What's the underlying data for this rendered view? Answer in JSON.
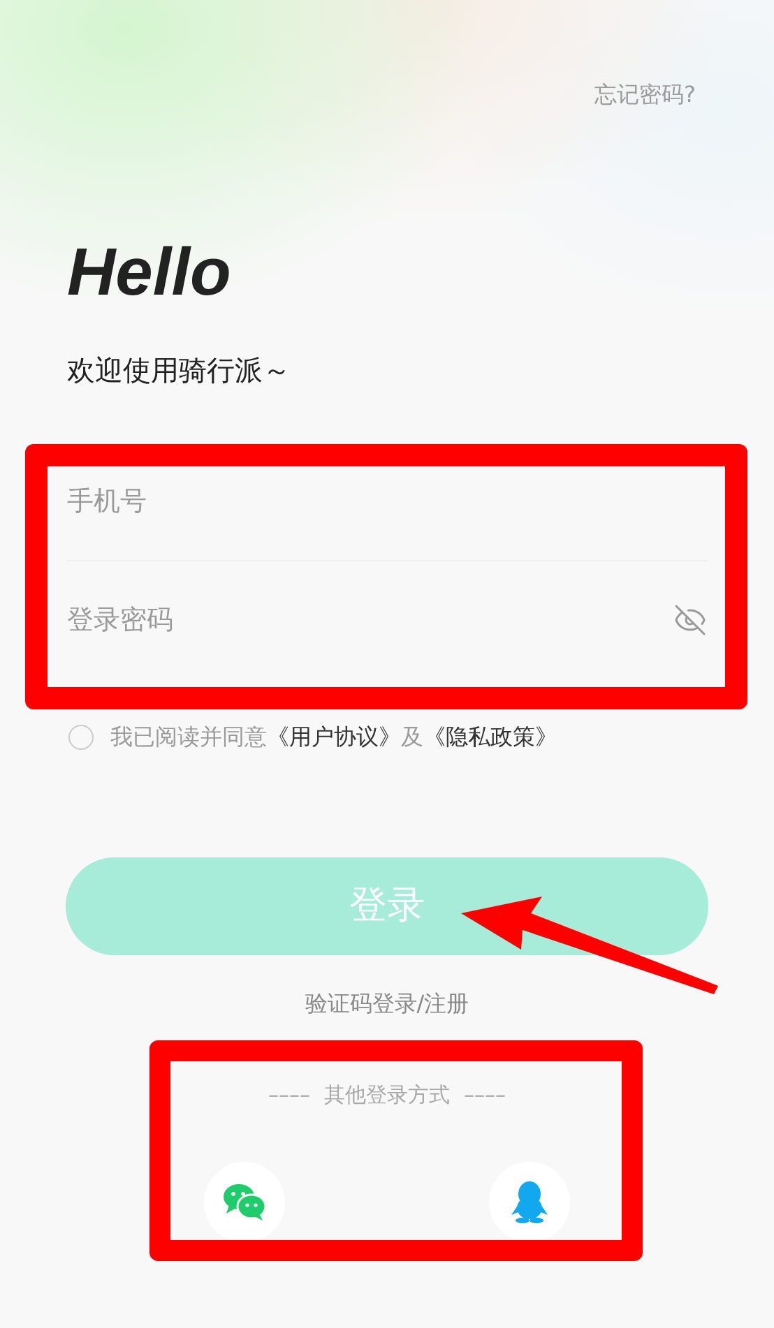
{
  "forgot_password": "忘记密码?",
  "greeting": "Hello",
  "welcome": "欢迎使用骑行派～",
  "fields": [
    {
      "kind": "text",
      "placeholder": "手机号"
    },
    {
      "kind": "password",
      "placeholder": "登录密码"
    }
  ],
  "agreement": {
    "checked": false,
    "text": "我已阅读并同意",
    "terms_link": "《用户协议》",
    "conjunction": "及",
    "privacy_link": "《隐私政策》"
  },
  "login_button": {
    "label": "登录",
    "disabled": true
  },
  "sms_login": "验证码登录/注册",
  "other_login": {
    "left_rule": "––––",
    "label": "其他登录方式",
    "right_rule": "––––"
  },
  "providers": [
    {
      "kind": "wechat"
    },
    {
      "kind": "qq"
    }
  ]
}
